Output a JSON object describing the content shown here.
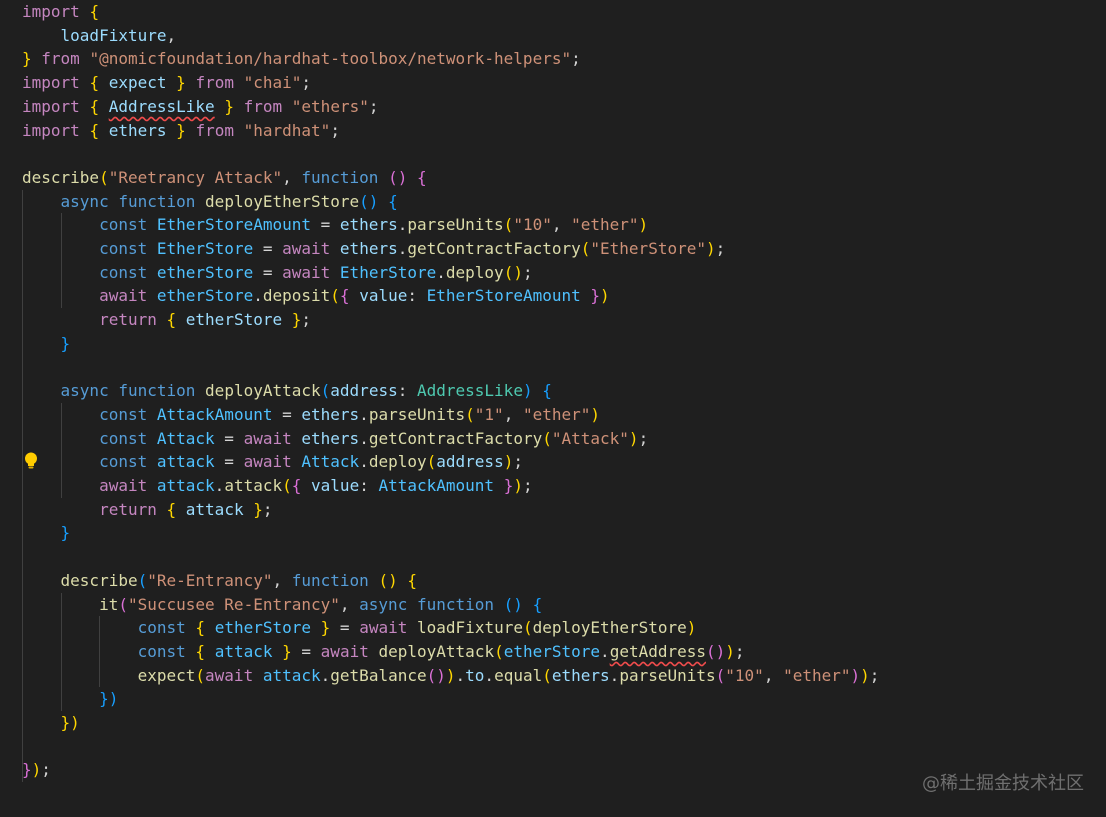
{
  "editor": {
    "theme_colors": {
      "background": "#1f1f1f",
      "keyword": "#c586c0",
      "storage": "#569cd6",
      "function": "#dcdcaa",
      "string": "#ce9178",
      "variable": "#9cdcfe",
      "constant": "#4fc1ff",
      "type": "#4ec9b0",
      "bracket_1": "#ffd700",
      "bracket_2": "#da70d6",
      "bracket_3": "#179fff",
      "error_squiggle": "#f14c4c"
    },
    "lightbulb_icon": "lightbulb-icon",
    "lines": [
      [
        [
          "import",
          "kw"
        ],
        [
          " ",
          "pun"
        ],
        [
          "{",
          "b1"
        ]
      ],
      [
        [
          "    ",
          "pun"
        ],
        [
          "loadFixture",
          "var"
        ],
        [
          ",",
          "pun"
        ]
      ],
      [
        [
          "}",
          "b1"
        ],
        [
          " ",
          "pun"
        ],
        [
          "from",
          "kw"
        ],
        [
          " ",
          "pun"
        ],
        [
          "\"@nomicfoundation/hardhat-toolbox/network-helpers\"",
          "str"
        ],
        [
          ";",
          "pun"
        ]
      ],
      [
        [
          "import",
          "kw"
        ],
        [
          " ",
          "pun"
        ],
        [
          "{",
          "b1"
        ],
        [
          " ",
          "pun"
        ],
        [
          "expect",
          "var"
        ],
        [
          " ",
          "pun"
        ],
        [
          "}",
          "b1"
        ],
        [
          " ",
          "pun"
        ],
        [
          "from",
          "kw"
        ],
        [
          " ",
          "pun"
        ],
        [
          "\"chai\"",
          "str"
        ],
        [
          ";",
          "pun"
        ]
      ],
      [
        [
          "import",
          "kw"
        ],
        [
          " ",
          "pun"
        ],
        [
          "{",
          "b1"
        ],
        [
          " ",
          "pun"
        ],
        [
          "AddressLike",
          "var",
          "squiggle"
        ],
        [
          " ",
          "pun"
        ],
        [
          "}",
          "b1"
        ],
        [
          " ",
          "pun"
        ],
        [
          "from",
          "kw"
        ],
        [
          " ",
          "pun"
        ],
        [
          "\"ethers\"",
          "str"
        ],
        [
          ";",
          "pun"
        ]
      ],
      [
        [
          "import",
          "kw"
        ],
        [
          " ",
          "pun"
        ],
        [
          "{",
          "b1"
        ],
        [
          " ",
          "pun"
        ],
        [
          "ethers",
          "var"
        ],
        [
          " ",
          "pun"
        ],
        [
          "}",
          "b1"
        ],
        [
          " ",
          "pun"
        ],
        [
          "from",
          "kw"
        ],
        [
          " ",
          "pun"
        ],
        [
          "\"hardhat\"",
          "str"
        ],
        [
          ";",
          "pun"
        ]
      ],
      [],
      [
        [
          "describe",
          "fn"
        ],
        [
          "(",
          "b1"
        ],
        [
          "\"Reetrancy Attack\"",
          "str"
        ],
        [
          ", ",
          "pun"
        ],
        [
          "function",
          "st"
        ],
        [
          " ",
          "pun"
        ],
        [
          "()",
          "b2"
        ],
        [
          " ",
          "pun"
        ],
        [
          "{",
          "b2"
        ]
      ],
      [
        [
          "    ",
          "pun"
        ],
        [
          "async",
          "st"
        ],
        [
          " ",
          "pun"
        ],
        [
          "function",
          "st"
        ],
        [
          " ",
          "pun"
        ],
        [
          "deployEtherStore",
          "fn"
        ],
        [
          "()",
          "b3"
        ],
        [
          " ",
          "pun"
        ],
        [
          "{",
          "b3"
        ]
      ],
      [
        [
          "        ",
          "pun"
        ],
        [
          "const",
          "st"
        ],
        [
          " ",
          "pun"
        ],
        [
          "EtherStoreAmount",
          "const"
        ],
        [
          " = ",
          "pun"
        ],
        [
          "ethers",
          "var"
        ],
        [
          ".",
          "pun"
        ],
        [
          "parseUnits",
          "fn"
        ],
        [
          "(",
          "b1"
        ],
        [
          "\"10\"",
          "str"
        ],
        [
          ", ",
          "pun"
        ],
        [
          "\"ether\"",
          "str"
        ],
        [
          ")",
          "b1"
        ]
      ],
      [
        [
          "        ",
          "pun"
        ],
        [
          "const",
          "st"
        ],
        [
          " ",
          "pun"
        ],
        [
          "EtherStore",
          "const"
        ],
        [
          " = ",
          "pun"
        ],
        [
          "await",
          "kw"
        ],
        [
          " ",
          "pun"
        ],
        [
          "ethers",
          "var"
        ],
        [
          ".",
          "pun"
        ],
        [
          "getContractFactory",
          "fn"
        ],
        [
          "(",
          "b1"
        ],
        [
          "\"EtherStore\"",
          "str"
        ],
        [
          ")",
          "b1"
        ],
        [
          ";",
          "pun"
        ]
      ],
      [
        [
          "        ",
          "pun"
        ],
        [
          "const",
          "st"
        ],
        [
          " ",
          "pun"
        ],
        [
          "etherStore",
          "const"
        ],
        [
          " = ",
          "pun"
        ],
        [
          "await",
          "kw"
        ],
        [
          " ",
          "pun"
        ],
        [
          "EtherStore",
          "const"
        ],
        [
          ".",
          "pun"
        ],
        [
          "deploy",
          "fn"
        ],
        [
          "()",
          "b1"
        ],
        [
          ";",
          "pun"
        ]
      ],
      [
        [
          "        ",
          "pun"
        ],
        [
          "await",
          "kw"
        ],
        [
          " ",
          "pun"
        ],
        [
          "etherStore",
          "const"
        ],
        [
          ".",
          "pun"
        ],
        [
          "deposit",
          "fn"
        ],
        [
          "(",
          "b1"
        ],
        [
          "{",
          "b2"
        ],
        [
          " ",
          "pun"
        ],
        [
          "value",
          "var"
        ],
        [
          ": ",
          "pun"
        ],
        [
          "EtherStoreAmount",
          "const"
        ],
        [
          " ",
          "pun"
        ],
        [
          "}",
          "b2"
        ],
        [
          ")",
          "b1"
        ]
      ],
      [
        [
          "        ",
          "pun"
        ],
        [
          "return",
          "kw"
        ],
        [
          " ",
          "pun"
        ],
        [
          "{",
          "b1"
        ],
        [
          " ",
          "pun"
        ],
        [
          "etherStore",
          "var"
        ],
        [
          " ",
          "pun"
        ],
        [
          "}",
          "b1"
        ],
        [
          ";",
          "pun"
        ]
      ],
      [
        [
          "    ",
          "pun"
        ],
        [
          "}",
          "b3"
        ]
      ],
      [],
      [
        [
          "    ",
          "pun"
        ],
        [
          "async",
          "st"
        ],
        [
          " ",
          "pun"
        ],
        [
          "function",
          "st"
        ],
        [
          " ",
          "pun"
        ],
        [
          "deployAttack",
          "fn"
        ],
        [
          "(",
          "b3"
        ],
        [
          "address",
          "var"
        ],
        [
          ": ",
          "pun"
        ],
        [
          "AddressLike",
          "type"
        ],
        [
          ")",
          "b3"
        ],
        [
          " ",
          "pun"
        ],
        [
          "{",
          "b3"
        ]
      ],
      [
        [
          "        ",
          "pun"
        ],
        [
          "const",
          "st"
        ],
        [
          " ",
          "pun"
        ],
        [
          "AttackAmount",
          "const"
        ],
        [
          " = ",
          "pun"
        ],
        [
          "ethers",
          "var"
        ],
        [
          ".",
          "pun"
        ],
        [
          "parseUnits",
          "fn"
        ],
        [
          "(",
          "b1"
        ],
        [
          "\"1\"",
          "str"
        ],
        [
          ", ",
          "pun"
        ],
        [
          "\"ether\"",
          "str"
        ],
        [
          ")",
          "b1"
        ]
      ],
      [
        [
          "        ",
          "pun"
        ],
        [
          "const",
          "st"
        ],
        [
          " ",
          "pun"
        ],
        [
          "Attack",
          "const"
        ],
        [
          " = ",
          "pun"
        ],
        [
          "await",
          "kw"
        ],
        [
          " ",
          "pun"
        ],
        [
          "ethers",
          "var"
        ],
        [
          ".",
          "pun"
        ],
        [
          "getContractFactory",
          "fn"
        ],
        [
          "(",
          "b1"
        ],
        [
          "\"Attack\"",
          "str"
        ],
        [
          ")",
          "b1"
        ],
        [
          ";",
          "pun"
        ]
      ],
      [
        [
          "        ",
          "pun"
        ],
        [
          "const",
          "st"
        ],
        [
          " ",
          "pun"
        ],
        [
          "attack",
          "const"
        ],
        [
          " = ",
          "pun"
        ],
        [
          "await",
          "kw"
        ],
        [
          " ",
          "pun"
        ],
        [
          "Attack",
          "const"
        ],
        [
          ".",
          "pun"
        ],
        [
          "deploy",
          "fn"
        ],
        [
          "(",
          "b1"
        ],
        [
          "address",
          "var"
        ],
        [
          ")",
          "b1"
        ],
        [
          ";",
          "pun"
        ]
      ],
      [
        [
          "        ",
          "pun"
        ],
        [
          "await",
          "kw"
        ],
        [
          " ",
          "pun"
        ],
        [
          "attack",
          "const"
        ],
        [
          ".",
          "pun"
        ],
        [
          "attack",
          "fn"
        ],
        [
          "(",
          "b1"
        ],
        [
          "{",
          "b2"
        ],
        [
          " ",
          "pun"
        ],
        [
          "value",
          "var"
        ],
        [
          ": ",
          "pun"
        ],
        [
          "AttackAmount",
          "const"
        ],
        [
          " ",
          "pun"
        ],
        [
          "}",
          "b2"
        ],
        [
          ")",
          "b1"
        ],
        [
          ";",
          "pun"
        ]
      ],
      [
        [
          "        ",
          "pun"
        ],
        [
          "return",
          "kw"
        ],
        [
          " ",
          "pun"
        ],
        [
          "{",
          "b1"
        ],
        [
          " ",
          "pun"
        ],
        [
          "attack",
          "var"
        ],
        [
          " ",
          "pun"
        ],
        [
          "}",
          "b1"
        ],
        [
          ";",
          "pun"
        ]
      ],
      [
        [
          "    ",
          "pun"
        ],
        [
          "}",
          "b3"
        ]
      ],
      [],
      [
        [
          "    ",
          "pun"
        ],
        [
          "describe",
          "fn"
        ],
        [
          "(",
          "b3"
        ],
        [
          "\"Re-Entrancy\"",
          "str"
        ],
        [
          ", ",
          "pun"
        ],
        [
          "function",
          "st"
        ],
        [
          " ",
          "pun"
        ],
        [
          "()",
          "b1"
        ],
        [
          " ",
          "pun"
        ],
        [
          "{",
          "b1"
        ]
      ],
      [
        [
          "        ",
          "pun"
        ],
        [
          "it",
          "fn"
        ],
        [
          "(",
          "b2"
        ],
        [
          "\"Succusee Re-Entrancy\"",
          "str"
        ],
        [
          ", ",
          "pun"
        ],
        [
          "async",
          "st"
        ],
        [
          " ",
          "pun"
        ],
        [
          "function",
          "st"
        ],
        [
          " ",
          "pun"
        ],
        [
          "()",
          "b3"
        ],
        [
          " ",
          "pun"
        ],
        [
          "{",
          "b3"
        ]
      ],
      [
        [
          "            ",
          "pun"
        ],
        [
          "const",
          "st"
        ],
        [
          " ",
          "pun"
        ],
        [
          "{",
          "b1"
        ],
        [
          " ",
          "pun"
        ],
        [
          "etherStore",
          "const"
        ],
        [
          " ",
          "pun"
        ],
        [
          "}",
          "b1"
        ],
        [
          " = ",
          "pun"
        ],
        [
          "await",
          "kw"
        ],
        [
          " ",
          "pun"
        ],
        [
          "loadFixture",
          "fn"
        ],
        [
          "(",
          "b1"
        ],
        [
          "deployEtherStore",
          "fn"
        ],
        [
          ")",
          "b1"
        ]
      ],
      [
        [
          "            ",
          "pun"
        ],
        [
          "const",
          "st"
        ],
        [
          " ",
          "pun"
        ],
        [
          "{",
          "b1"
        ],
        [
          " ",
          "pun"
        ],
        [
          "attack",
          "const"
        ],
        [
          " ",
          "pun"
        ],
        [
          "}",
          "b1"
        ],
        [
          " = ",
          "pun"
        ],
        [
          "await",
          "kw"
        ],
        [
          " ",
          "pun"
        ],
        [
          "deployAttack",
          "fn"
        ],
        [
          "(",
          "b1"
        ],
        [
          "etherStore",
          "const"
        ],
        [
          ".",
          "pun"
        ],
        [
          "getAddress",
          "fn",
          "squiggle"
        ],
        [
          "()",
          "b2"
        ],
        [
          ")",
          "b1"
        ],
        [
          ";",
          "pun"
        ]
      ],
      [
        [
          "            ",
          "pun"
        ],
        [
          "expect",
          "fn"
        ],
        [
          "(",
          "b1"
        ],
        [
          "await",
          "kw"
        ],
        [
          " ",
          "pun"
        ],
        [
          "attack",
          "const"
        ],
        [
          ".",
          "pun"
        ],
        [
          "getBalance",
          "fn"
        ],
        [
          "()",
          "b2"
        ],
        [
          ")",
          "b1"
        ],
        [
          ".",
          "pun"
        ],
        [
          "to",
          "var"
        ],
        [
          ".",
          "pun"
        ],
        [
          "equal",
          "fn"
        ],
        [
          "(",
          "b1"
        ],
        [
          "ethers",
          "var"
        ],
        [
          ".",
          "pun"
        ],
        [
          "parseUnits",
          "fn"
        ],
        [
          "(",
          "b2"
        ],
        [
          "\"10\"",
          "str"
        ],
        [
          ", ",
          "pun"
        ],
        [
          "\"ether\"",
          "str"
        ],
        [
          ")",
          "b2"
        ],
        [
          ")",
          "b1"
        ],
        [
          ";",
          "pun"
        ]
      ],
      [
        [
          "        ",
          "pun"
        ],
        [
          "})",
          "b3"
        ]
      ],
      [
        [
          "    ",
          "pun"
        ],
        [
          "})",
          "b1"
        ]
      ],
      [],
      [
        [
          "}",
          "b2"
        ],
        [
          ")",
          "b1"
        ],
        [
          ";",
          "pun"
        ]
      ]
    ]
  },
  "watermark": {
    "text": "@稀土掘金技术社区"
  }
}
